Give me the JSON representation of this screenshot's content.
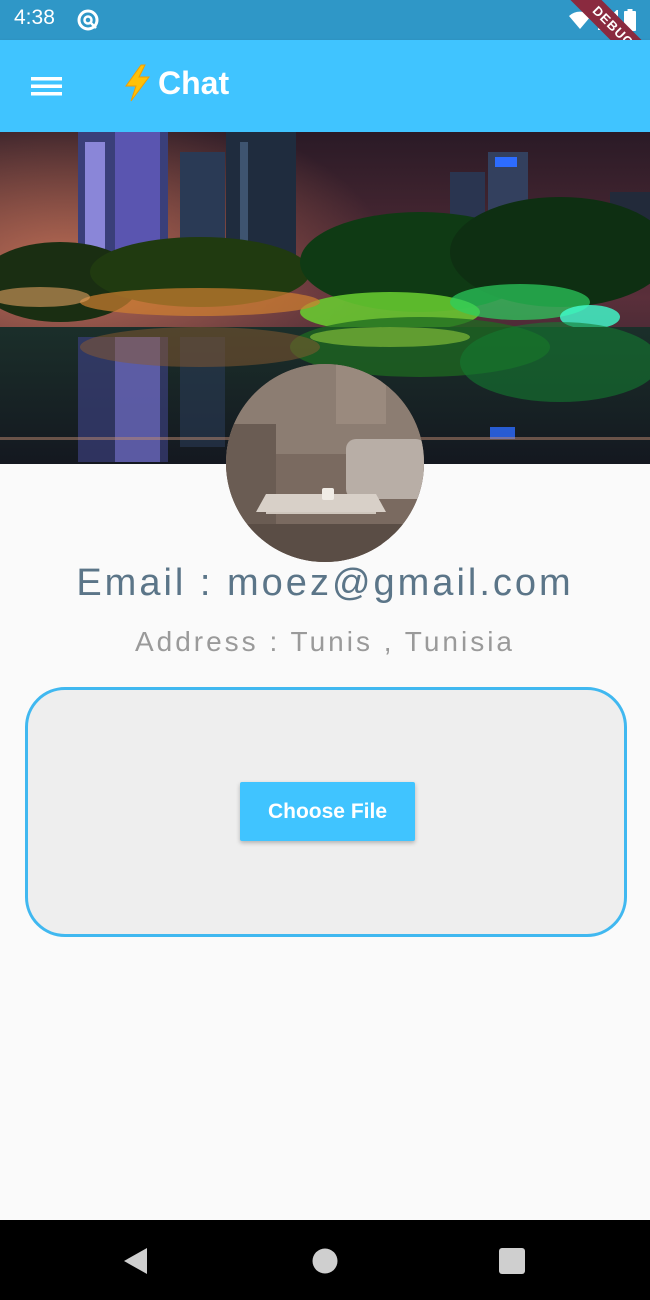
{
  "status_bar": {
    "time": "4:38",
    "icons": [
      "at-sign-icon",
      "wifi-icon",
      "signal-icon",
      "battery-icon"
    ],
    "debug_label": "DEBUG"
  },
  "app_bar": {
    "title": "Chat",
    "menu_icon": "hamburger-menu-icon",
    "title_icon": "lightning-bolt-icon",
    "background": "#40c4ff"
  },
  "profile": {
    "email_text": "Email : moez@gmail.com",
    "address_text": "Address : Tunis , Tunisia"
  },
  "upload": {
    "button_label": "Choose File",
    "border_color": "#40b8f0"
  },
  "nav_bar": {
    "icons": [
      "back-icon",
      "home-icon",
      "recents-icon"
    ]
  },
  "colors": {
    "accent": "#40c4ff",
    "status_bar": "#2f97c7",
    "email_text": "#5b7588",
    "address_text": "#9a9a9a"
  }
}
